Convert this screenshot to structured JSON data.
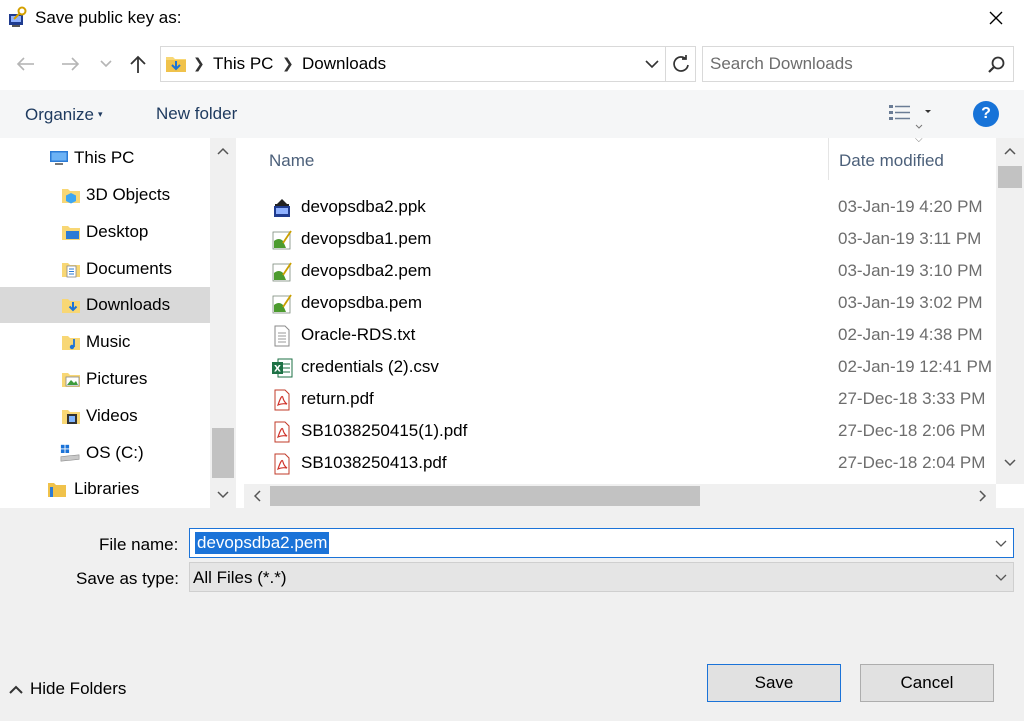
{
  "window": {
    "title": "Save public key as:",
    "title_icon": "puttygen-key-icon",
    "close_icon": "close-icon"
  },
  "navigation": {
    "back_icon": "arrow-left-icon",
    "forward_icon": "arrow-right-icon",
    "recent_icon": "chevron-down-icon",
    "up_icon": "arrow-up-icon",
    "breadcrumbs": [
      "This PC",
      "Downloads"
    ],
    "refresh_icon": "refresh-icon",
    "search_placeholder": "Search Downloads"
  },
  "toolbar": {
    "organize_label": "Organize",
    "new_folder_label": "New folder",
    "view_icon": "list-view-icon",
    "help_label": "?"
  },
  "nav_pane": {
    "items": [
      {
        "label": "This PC",
        "icon": "computer-icon",
        "indent": 1,
        "selected": false
      },
      {
        "label": "3D Objects",
        "icon": "folder-3d-icon",
        "indent": 2,
        "selected": false
      },
      {
        "label": "Desktop",
        "icon": "folder-desktop-icon",
        "indent": 2,
        "selected": false
      },
      {
        "label": "Documents",
        "icon": "folder-documents-icon",
        "indent": 2,
        "selected": false
      },
      {
        "label": "Downloads",
        "icon": "folder-downloads-icon",
        "indent": 2,
        "selected": true
      },
      {
        "label": "Music",
        "icon": "folder-music-icon",
        "indent": 2,
        "selected": false
      },
      {
        "label": "Pictures",
        "icon": "folder-pictures-icon",
        "indent": 2,
        "selected": false
      },
      {
        "label": "Videos",
        "icon": "folder-videos-icon",
        "indent": 2,
        "selected": false
      },
      {
        "label": "OS (C:)",
        "icon": "drive-icon",
        "indent": 2,
        "selected": false
      },
      {
        "label": "Libraries",
        "icon": "libraries-icon",
        "indent": 1,
        "selected": false
      }
    ]
  },
  "file_list": {
    "columns": {
      "name": "Name",
      "date": "Date modified"
    },
    "files": [
      {
        "name": "devopsdba2.ppk",
        "date": "03-Jan-19 4:20 PM",
        "type": "ppk"
      },
      {
        "name": "devopsdba1.pem",
        "date": "03-Jan-19 3:11 PM",
        "type": "pem"
      },
      {
        "name": "devopsdba2.pem",
        "date": "03-Jan-19 3:10 PM",
        "type": "pem"
      },
      {
        "name": "devopsdba.pem",
        "date": "03-Jan-19 3:02 PM",
        "type": "pem"
      },
      {
        "name": "Oracle-RDS.txt",
        "date": "02-Jan-19 4:38 PM",
        "type": "txt"
      },
      {
        "name": "credentials (2).csv",
        "date": "02-Jan-19 12:41 PM",
        "type": "csv"
      },
      {
        "name": "return.pdf",
        "date": "27-Dec-18 3:33 PM",
        "type": "pdf"
      },
      {
        "name": "SB1038250415(1).pdf",
        "date": "27-Dec-18 2:06 PM",
        "type": "pdf"
      },
      {
        "name": "SB1038250413.pdf",
        "date": "27-Dec-18 2:04 PM",
        "type": "pdf"
      }
    ]
  },
  "form": {
    "file_name_label": "File name:",
    "file_name_value": "devopsdba2.pem",
    "save_as_type_label": "Save as type:",
    "save_as_type_value": "All Files (*.*)"
  },
  "footer": {
    "hide_folders_label": "Hide Folders",
    "save_label": "Save",
    "cancel_label": "Cancel"
  },
  "colors": {
    "accent": "#1b73d8",
    "toolbar_text": "#1e3a5f",
    "selected_nav": "#d9d9d9"
  }
}
